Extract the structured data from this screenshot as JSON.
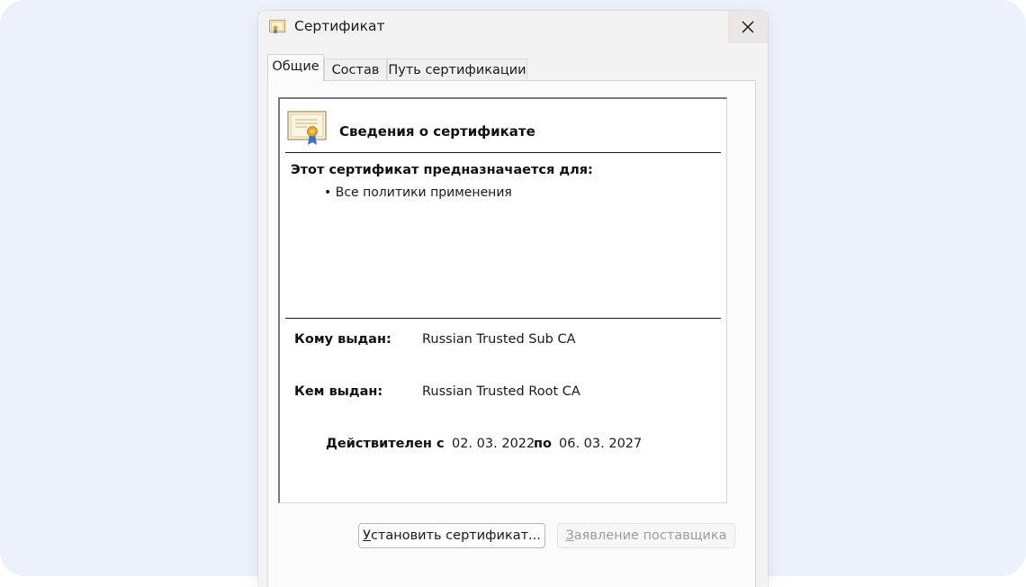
{
  "window": {
    "title": "Сертификат"
  },
  "tabs": [
    {
      "label": "Общие",
      "active": true
    },
    {
      "label": "Состав",
      "active": false
    },
    {
      "label": "Путь сертификации",
      "active": false
    }
  ],
  "general": {
    "heading": "Сведения о сертификате",
    "purpose_heading": "Этот сертификат предназначается для:",
    "purposes": [
      "• Все политики применения"
    ],
    "issued_to_label": "Кому выдан:",
    "issued_to_value": "Russian Trusted Sub CA",
    "issued_by_label": "Кем выдан:",
    "issued_by_value": "Russian Trusted Root CA",
    "valid_from_label": "Действителен с",
    "valid_from": "02. 03. 2022",
    "valid_to_label": "по",
    "valid_to": "06. 03. 2027"
  },
  "buttons": {
    "install_underline": "У",
    "install_rest": "становить сертификат...",
    "statement_underline": "З",
    "statement_rest": "аявление поставщика",
    "statement_disabled": true
  },
  "colors": {
    "backdrop": "#edf1fb",
    "dialog_bg": "#f3f3f3",
    "disabled_text": "#9d9d9d",
    "cert_ribbon": "#3b6fd1",
    "cert_seal": "#e0a526"
  },
  "icons": {
    "title": "certificate-icon",
    "close": "close-icon",
    "info": "certificate-document-icon"
  }
}
